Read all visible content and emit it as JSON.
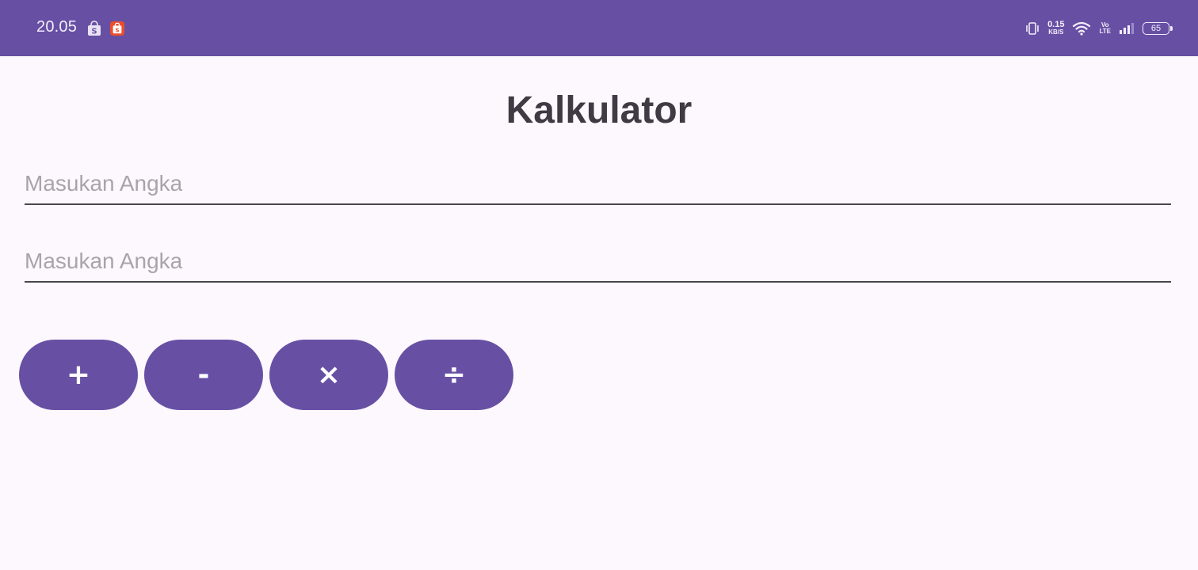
{
  "status_bar": {
    "time": "20.05",
    "net_speed_value": "0.15",
    "net_speed_unit": "KB/S",
    "volte_top": "Vo",
    "volte_bottom": "LTE",
    "battery": "65",
    "notification_icons": [
      "shopee-bag-icon",
      "shopee-bag-orange-icon"
    ],
    "color": "#6750a4"
  },
  "app": {
    "title": "Kalkulator",
    "input1": {
      "value": "",
      "placeholder": "Masukan Angka"
    },
    "input2": {
      "value": "",
      "placeholder": "Masukan Angka"
    },
    "buttons": {
      "add": "+",
      "subtract": "-",
      "multiply": "×",
      "divide": "÷"
    },
    "accent_color": "#6750a4",
    "background": "#fdf8fd"
  }
}
